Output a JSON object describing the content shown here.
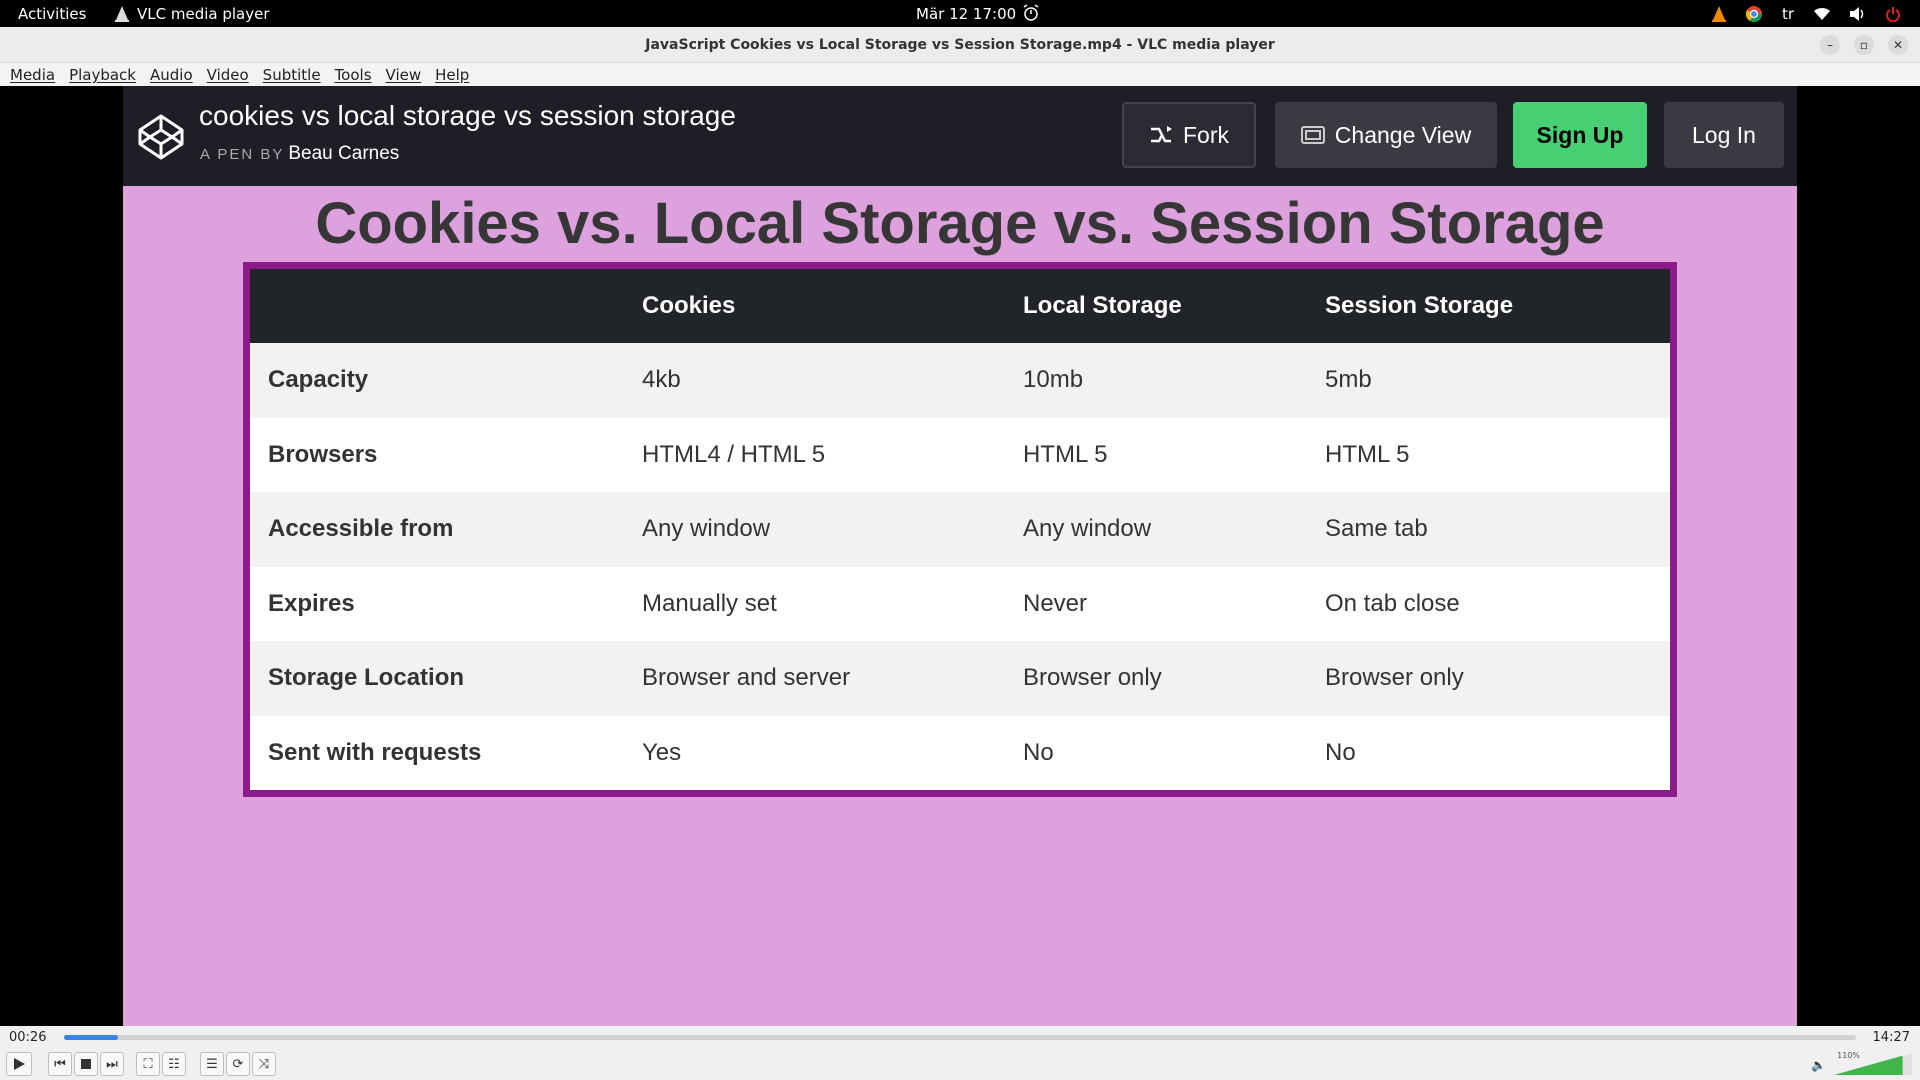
{
  "topbar": {
    "activities": "Activities",
    "app_name": "VLC media player",
    "clock": "Mär 12  17:00",
    "lang": "tr"
  },
  "window": {
    "title": "JavaScript Cookies vs Local Storage vs Session Storage.mp4 - VLC media player"
  },
  "menu": [
    "Media",
    "Playback",
    "Audio",
    "Video",
    "Subtitle",
    "Tools",
    "View",
    "Help"
  ],
  "codepen": {
    "pen_title": "cookies vs local storage vs session storage",
    "by_label": "A PEN BY",
    "author": "Beau Carnes",
    "fork": "Fork",
    "change_view": "Change View",
    "sign_up": "Sign Up",
    "log_in": "Log In"
  },
  "slide": {
    "heading": "Cookies vs. Local Storage vs. Session Storage",
    "columns": [
      "",
      "Cookies",
      "Local Storage",
      "Session Storage"
    ],
    "rows": [
      [
        "Capacity",
        "4kb",
        "10mb",
        "5mb"
      ],
      [
        "Browsers",
        "HTML4 / HTML 5",
        "HTML 5",
        "HTML 5"
      ],
      [
        "Accessible from",
        "Any window",
        "Any window",
        "Same tab"
      ],
      [
        "Expires",
        "Manually set",
        "Never",
        "On tab close"
      ],
      [
        "Storage Location",
        "Browser and server",
        "Browser only",
        "Browser only"
      ],
      [
        "Sent with requests",
        "Yes",
        "No",
        "No"
      ]
    ]
  },
  "player": {
    "current_time": "00:26",
    "total_time": "14:27",
    "progress_fraction": 0.03,
    "volume_label": "110%",
    "volume_fraction": 0.88
  },
  "colors": {
    "slide_bg": "#dda1dd",
    "table_border": "#8b1a8b",
    "signup_green": "#47cf73",
    "progress_blue": "#3584e4"
  }
}
